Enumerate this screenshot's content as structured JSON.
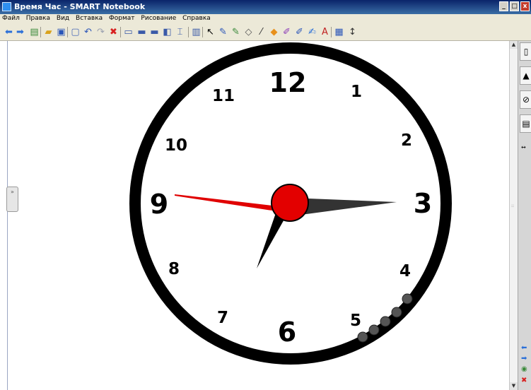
{
  "window": {
    "title": "Время Час - SMART Notebook",
    "min_glyph": "_",
    "max_glyph": "□",
    "close_glyph": "x"
  },
  "menu": [
    "Файл",
    "Правка",
    "Вид",
    "Вставка",
    "Формат",
    "Рисование",
    "Справка"
  ],
  "toolbar": {
    "buttons": [
      {
        "name": "back-arrow-icon",
        "glyph": "⬅",
        "color": "#2a6fd8"
      },
      {
        "name": "forward-arrow-icon",
        "glyph": "➡",
        "color": "#2a6fd8"
      },
      {
        "name": "add-page-icon",
        "glyph": "▤",
        "color": "#3a8a3a"
      },
      {
        "name": "open-folder-icon",
        "glyph": "▰",
        "color": "#d9a21b"
      },
      {
        "name": "save-icon",
        "glyph": "▣",
        "color": "#2a55b8"
      },
      {
        "name": "paste-icon",
        "glyph": "▢",
        "color": "#4a6ab8"
      },
      {
        "name": "undo-icon",
        "glyph": "↶",
        "color": "#2a55b8"
      },
      {
        "name": "redo-icon",
        "glyph": "↷",
        "color": "#9aa0b0"
      },
      {
        "name": "delete-icon",
        "glyph": "✖",
        "color": "#d82020"
      },
      {
        "name": "screen-shade-icon",
        "glyph": "▭",
        "color": "#3a5aa8"
      },
      {
        "name": "full-screen-icon",
        "glyph": "▬",
        "color": "#3a5aa8"
      },
      {
        "name": "dual-page-icon",
        "glyph": "▬",
        "color": "#3a5aa8"
      },
      {
        "name": "capture-icon",
        "glyph": "◧",
        "color": "#3a5aa8"
      },
      {
        "name": "document-camera-icon",
        "glyph": "⌶",
        "color": "#3a5aa8"
      },
      {
        "name": "table-icon",
        "glyph": "▥",
        "color": "#3a5aa8"
      },
      {
        "name": "select-pointer-icon",
        "glyph": "↖",
        "color": "#000000"
      },
      {
        "name": "pen-icon",
        "glyph": "✎",
        "color": "#2a55b8"
      },
      {
        "name": "creative-pen-icon",
        "glyph": "✎",
        "color": "#3a8a3a"
      },
      {
        "name": "eraser-icon",
        "glyph": "◇",
        "color": "#555555"
      },
      {
        "name": "line-icon",
        "glyph": "⁄",
        "color": "#333333"
      },
      {
        "name": "shapes-icon",
        "glyph": "◆",
        "color": "#e8901a"
      },
      {
        "name": "fill-icon",
        "glyph": "✐",
        "color": "#8a3ab8"
      },
      {
        "name": "magic-pen-icon",
        "glyph": "✐",
        "color": "#2a55b8"
      },
      {
        "name": "recognition-pen-icon",
        "glyph": "✍",
        "color": "#2a6fd8"
      },
      {
        "name": "text-icon",
        "glyph": "A",
        "color": "#c02020"
      },
      {
        "name": "properties-icon",
        "glyph": "▦",
        "color": "#2a55b8"
      },
      {
        "name": "toolbar-move-icon",
        "glyph": "↕",
        "color": "#333333"
      }
    ]
  },
  "clock": {
    "numbers": [
      "12",
      "1",
      "2",
      "3",
      "4",
      "5",
      "6",
      "7",
      "8",
      "9",
      "10",
      "11"
    ],
    "face_color": "#ffffff",
    "rim_color": "#000000",
    "hour_hand_color": "#000000",
    "minute_hand_color": "#333333",
    "second_hand_color": "#e00000",
    "center_cap_color": "#e30000",
    "time_shown": {
      "hour_hand_points_at": "7",
      "minute_hand_points_at": "3",
      "second_hand_points_at": "9"
    }
  },
  "side_handle": {
    "glyph": "»"
  },
  "scrollbar": {
    "up_glyph": "▲",
    "down_glyph": "▼",
    "grip_glyph": "::"
  },
  "side_panel": {
    "tabs": [
      {
        "name": "page-sorter-tab-icon",
        "glyph": "▯"
      },
      {
        "name": "gallery-tab-icon",
        "glyph": "▲"
      },
      {
        "name": "attachments-tab-icon",
        "glyph": "⊘"
      },
      {
        "name": "properties-tab-icon",
        "glyph": "▤"
      }
    ],
    "resize_glyph": "↔",
    "nav_buttons": [
      {
        "name": "previous-page-icon",
        "glyph": "⬅",
        "color": "#2a6fd8"
      },
      {
        "name": "next-page-icon",
        "glyph": "➡",
        "color": "#2a6fd8"
      },
      {
        "name": "add-page-icon",
        "glyph": "◉",
        "color": "#3a8a3a"
      },
      {
        "name": "delete-page-icon",
        "glyph": "✖",
        "color": "#d82020"
      }
    ]
  }
}
